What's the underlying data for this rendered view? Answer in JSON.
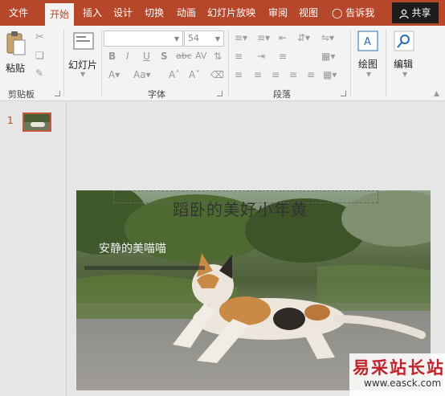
{
  "tabs": [
    {
      "label": "文件",
      "active": false
    },
    {
      "label": "开始",
      "active": true
    },
    {
      "label": "插入",
      "active": false
    },
    {
      "label": "设计",
      "active": false
    },
    {
      "label": "切换",
      "active": false
    },
    {
      "label": "动画",
      "active": false
    },
    {
      "label": "幻灯片放映",
      "active": false
    },
    {
      "label": "审阅",
      "active": false
    },
    {
      "label": "视图",
      "active": false
    }
  ],
  "tell_me": "告诉我",
  "share": "共享",
  "ribbon": {
    "paste": "粘贴",
    "new_slide": "幻灯片",
    "font_size": "54",
    "font_name": "",
    "draw": "绘图",
    "edit": "编辑",
    "bold": "B",
    "italic": "I",
    "underline": "U",
    "shadow": "S",
    "strike": "abc",
    "spacing": "AV",
    "groups": {
      "clipboard": "剪贴板",
      "font": "字体",
      "paragraph": "段落"
    }
  },
  "slide_pane": {
    "slide_number": "1"
  },
  "slide": {
    "title": "蹈卧的美好小年黄",
    "subtitle": "安静的美喵喵"
  },
  "watermark": {
    "name": "易采站长站",
    "url": "www.easck.com"
  },
  "colors": {
    "accent": "#b7472a",
    "ribbon_bg": "#f3f3f3",
    "share_bg": "#1b1b1b"
  }
}
